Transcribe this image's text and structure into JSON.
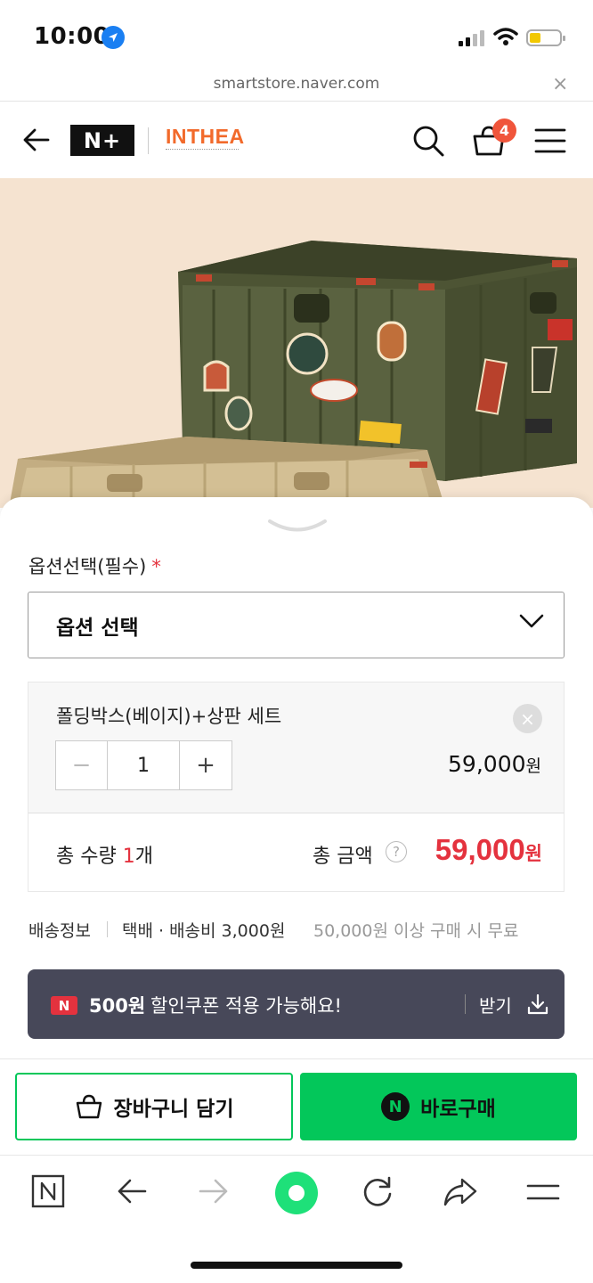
{
  "status_bar": {
    "time": "10:00"
  },
  "browser": {
    "url": "smartstore.naver.com",
    "close_label": "×"
  },
  "header": {
    "nplus_logo": "N+",
    "brand": "INTHEA",
    "cart_count": "4"
  },
  "option": {
    "label": "옵션선택(필수)",
    "required_mark": "*",
    "select_placeholder": "옵션 선택"
  },
  "selected_item": {
    "name": "폴딩박스(베이지)+상판 세트",
    "remove_label": "×",
    "quantity": "1",
    "minus_label": "−",
    "plus_label": "+",
    "price": "59,000",
    "price_unit": "원"
  },
  "total": {
    "qty_prefix": "총 수량 ",
    "qty_value": "1",
    "qty_suffix": "개",
    "amount_label": "총 금액",
    "help_label": "?",
    "price": "59,000",
    "price_unit": "원"
  },
  "shipping": {
    "label": "배송정보",
    "fee": "택배 · 배송비 3,000원",
    "free_condition": "50,000원 이상 구매 시 무료"
  },
  "coupon": {
    "badge": "N",
    "amount": "500원",
    "text": "할인쿠폰 적용 가능해요!",
    "get_label": "받기"
  },
  "actions": {
    "cart_label": "장바구니 담기",
    "buy_badge": "N",
    "buy_label": "바로구매"
  },
  "colors": {
    "naver_green": "#03c75a",
    "price_red": "#e4323e",
    "brand_orange": "#f26a2b",
    "coupon_bg": "#474859"
  }
}
